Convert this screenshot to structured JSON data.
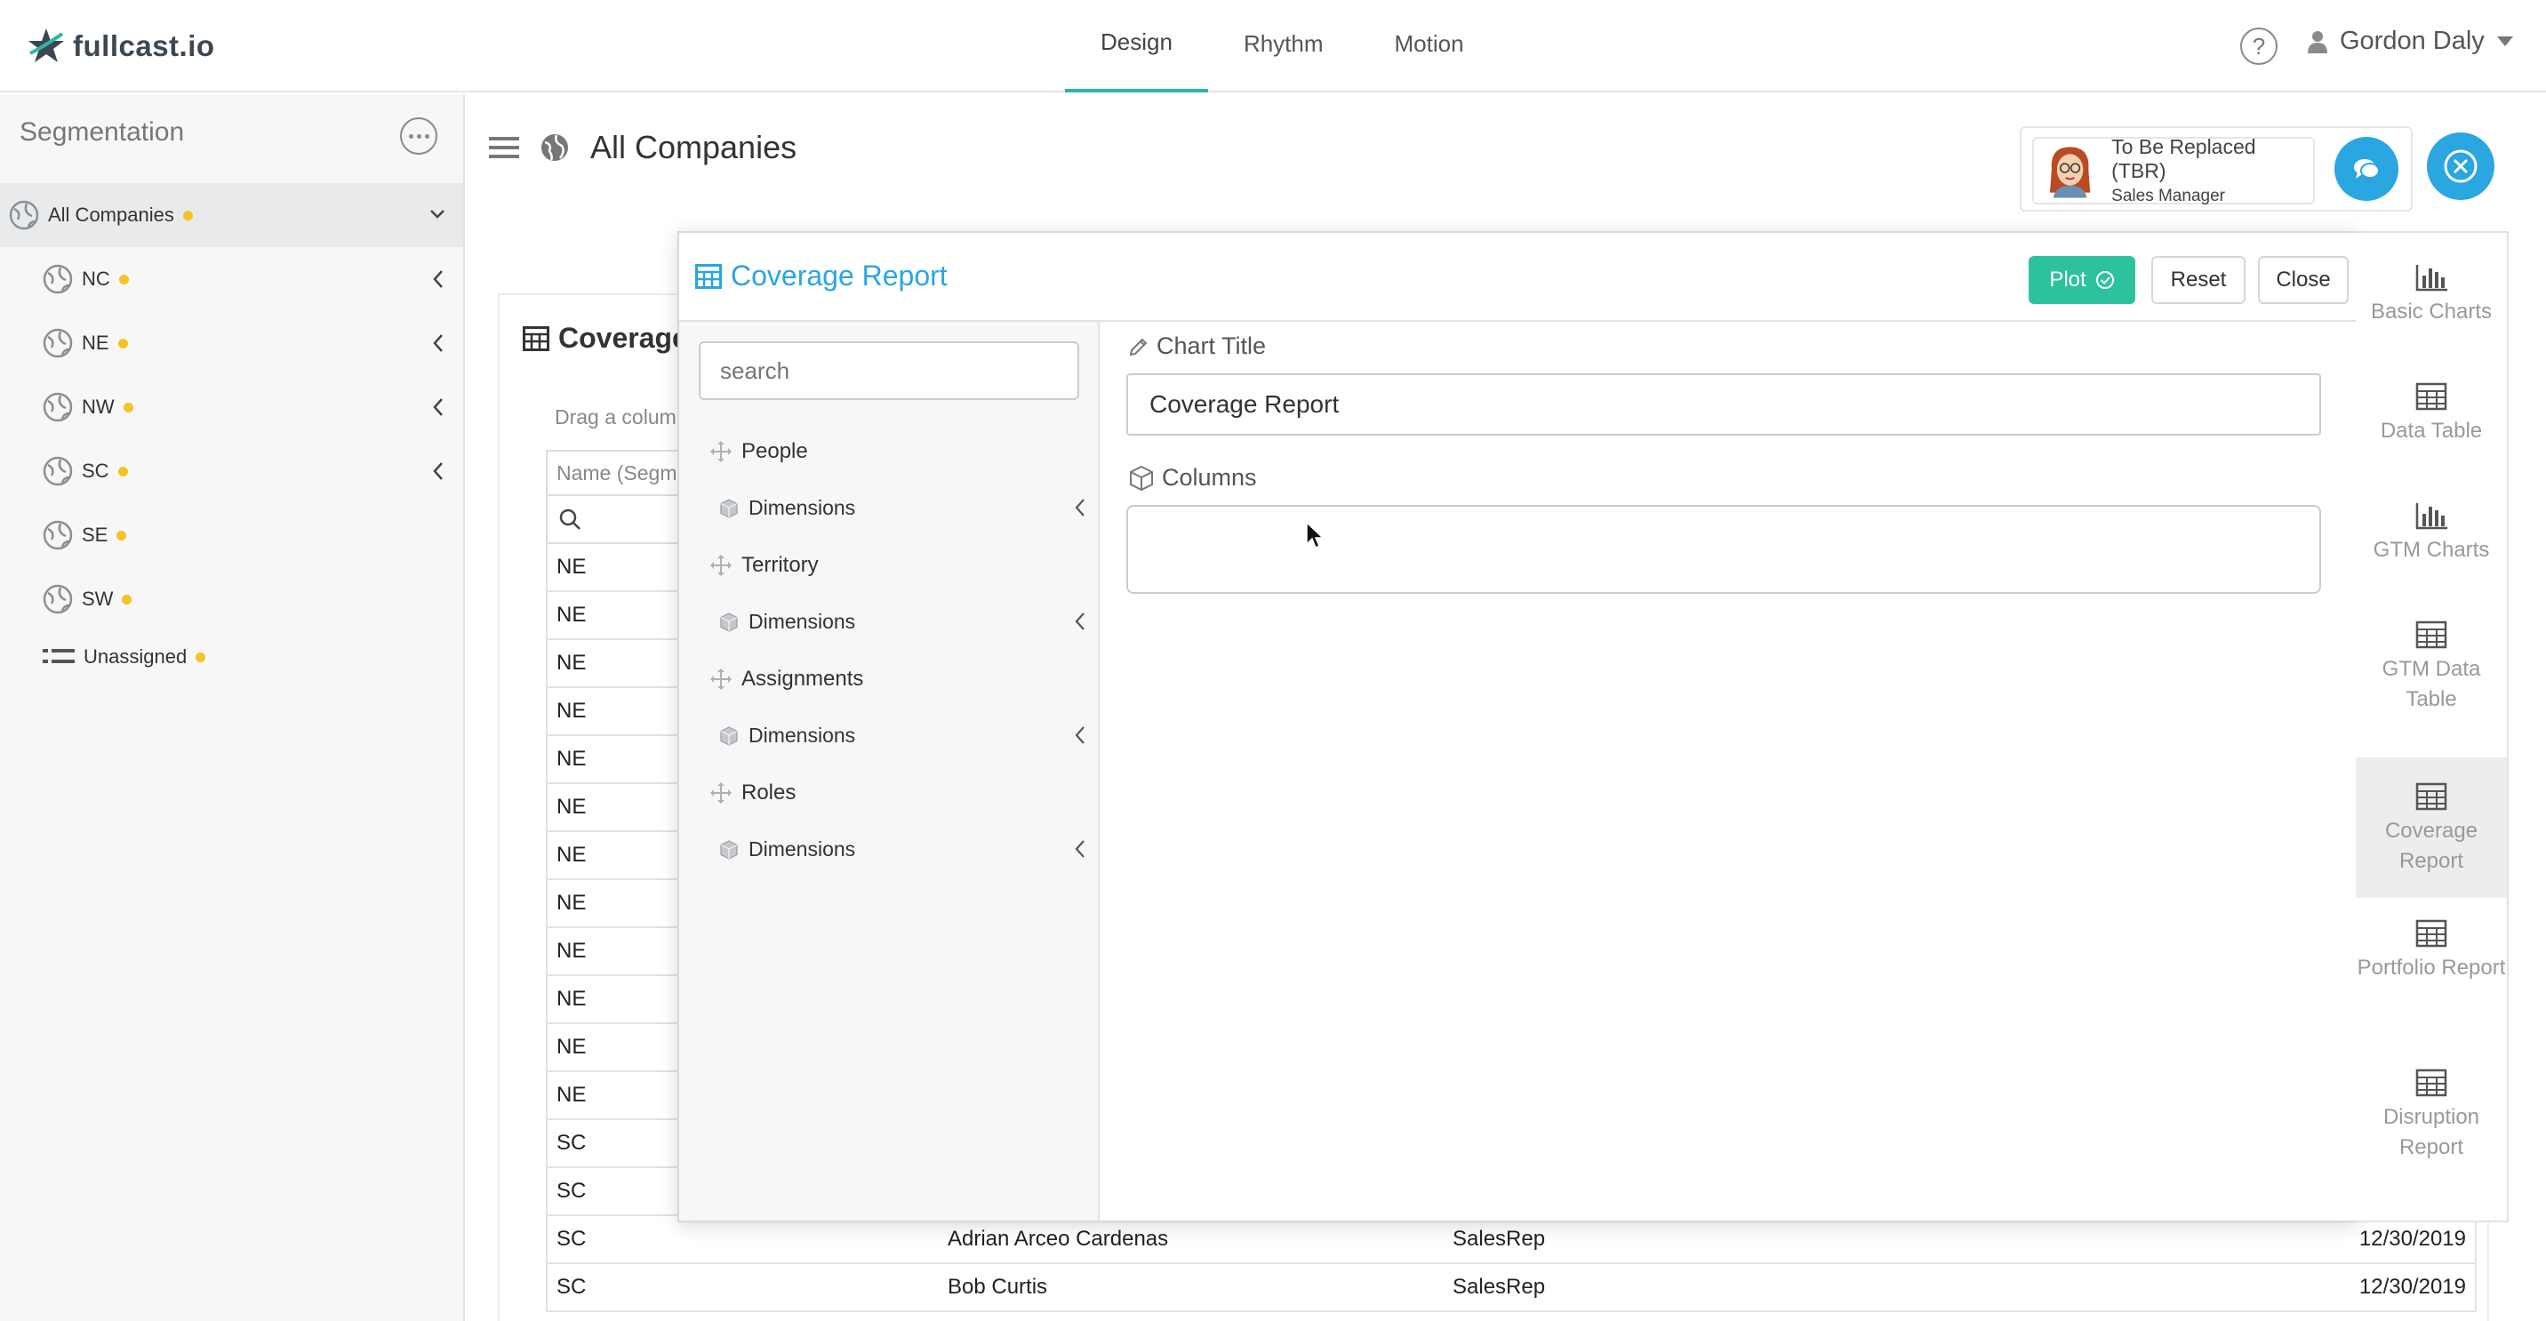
{
  "app": {
    "logo_text": "fullcast.io"
  },
  "nav": {
    "tabs": [
      "Design",
      "Rhythm",
      "Motion"
    ],
    "active_tab": "Design"
  },
  "user": {
    "name": "Gordon Daly",
    "help_label": "?"
  },
  "sidebar": {
    "title": "Segmentation",
    "root": "All Companies",
    "items": [
      {
        "label": "NC",
        "expandable": true
      },
      {
        "label": "NE",
        "expandable": true
      },
      {
        "label": "NW",
        "expandable": true
      },
      {
        "label": "SC",
        "expandable": true
      },
      {
        "label": "SE",
        "expandable": false
      },
      {
        "label": "SW",
        "expandable": false
      }
    ],
    "unassigned": "Unassigned",
    "dot_color": "#f5c324"
  },
  "page": {
    "title": "All Companies"
  },
  "tbr": {
    "name": "To Be Replaced (TBR)",
    "role": "Sales Manager"
  },
  "background_table": {
    "title": "Coverage",
    "drag_hint": "Drag a colum",
    "first_column_header": "Name (Segm",
    "rows": [
      [
        "NE",
        "",
        "",
        ""
      ],
      [
        "NE",
        "",
        "",
        ""
      ],
      [
        "NE",
        "",
        "",
        ""
      ],
      [
        "NE",
        "",
        "",
        ""
      ],
      [
        "NE",
        "",
        "",
        ""
      ],
      [
        "NE",
        "",
        "",
        ""
      ],
      [
        "NE",
        "",
        "",
        ""
      ],
      [
        "NE",
        "",
        "",
        ""
      ],
      [
        "NE",
        "",
        "",
        ""
      ],
      [
        "NE",
        "",
        "",
        ""
      ],
      [
        "NE",
        "",
        "",
        ""
      ],
      [
        "NE",
        "",
        "",
        ""
      ],
      [
        "SC",
        "",
        "",
        ""
      ],
      [
        "SC",
        "",
        "",
        ""
      ],
      [
        "SC",
        "Adrian Arceo Cardenas",
        "SalesRep",
        "12/30/2019"
      ],
      [
        "SC",
        "Bob Curtis",
        "SalesRep",
        "12/30/2019"
      ]
    ]
  },
  "modal": {
    "title": "Coverage Report",
    "buttons": {
      "plot": "Plot",
      "reset": "Reset",
      "close": "Close"
    },
    "search_placeholder": "search",
    "field_groups": [
      {
        "label": "People",
        "dimensions": "Dimensions"
      },
      {
        "label": "Territory",
        "dimensions": "Dimensions"
      },
      {
        "label": "Assignments",
        "dimensions": "Dimensions"
      },
      {
        "label": "Roles",
        "dimensions": "Dimensions"
      }
    ],
    "chart_title_label": "Chart Title",
    "chart_title_value": "Coverage Report",
    "columns_label": "Columns"
  },
  "rail": {
    "items": [
      {
        "label": "Basic Charts",
        "icon": "bar-chart-icon"
      },
      {
        "label": "Data Table",
        "icon": "table-icon"
      },
      {
        "label": "GTM Charts",
        "icon": "bar-chart-icon"
      },
      {
        "label": "GTM Data Table",
        "icon": "table-icon"
      },
      {
        "label": "Coverage Report",
        "icon": "table-icon",
        "active": true
      },
      {
        "label": "Portfolio Report",
        "icon": "table-icon"
      },
      {
        "label": "Disruption Report",
        "icon": "table-icon"
      }
    ]
  },
  "colors": {
    "accent": "#2aa6e0",
    "plot_button": "#2ec19d",
    "active_tab_underline": "#2fb5a4"
  }
}
